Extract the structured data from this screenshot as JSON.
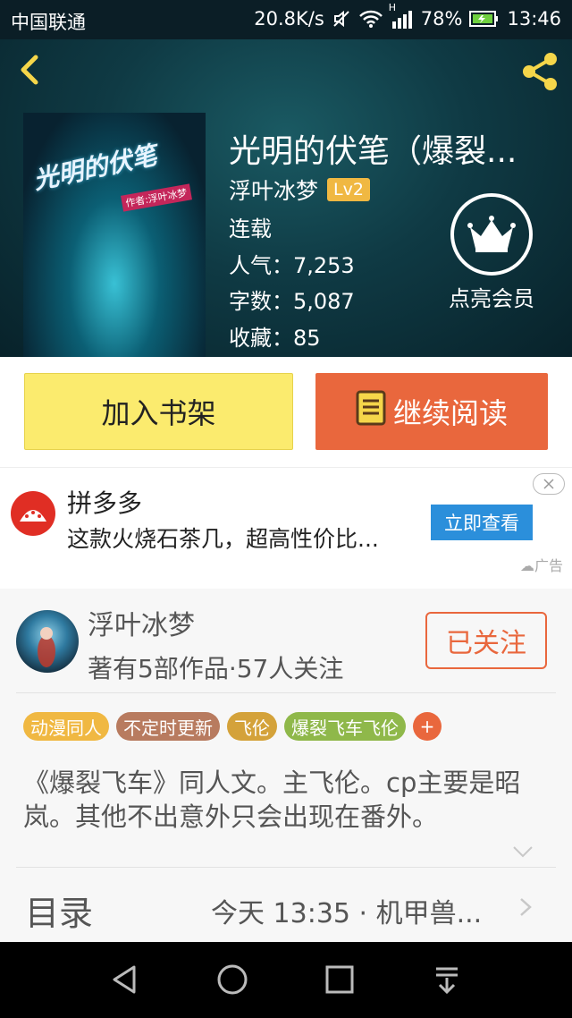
{
  "status_bar": {
    "carrier": "中国联通",
    "net_speed": "20.8K/s",
    "signal_label": "H",
    "battery": "78%",
    "time": "13:46"
  },
  "header": {
    "back_icon": "chevron-left-icon",
    "share_icon": "share-icon"
  },
  "book": {
    "cover_title": "光明的伏笔",
    "cover_subtitle": "作者:浮叶冰梦",
    "title": "光明的伏笔（爆裂...",
    "author": "浮叶冰梦",
    "level": "Lv2",
    "status": "连载",
    "popularity": "人气：7,253",
    "word_count": "字数：5,087",
    "favorites": "收藏：85"
  },
  "vip": {
    "label": "点亮会员",
    "icon": "crown-icon"
  },
  "actions": {
    "add_shelf": "加入书架",
    "continue_read": "继续阅读"
  },
  "ad": {
    "brand": "拼多多",
    "desc": "这款火烧石茶几，超高性价比...",
    "button": "立即查看",
    "tag": "广告"
  },
  "author_card": {
    "name": "浮叶冰梦",
    "stats": "著有5部作品·57人关注",
    "follow": "已关注"
  },
  "tags": [
    {
      "label": "动漫同人",
      "color": "#f0b842"
    },
    {
      "label": "不定时更新",
      "color": "#b87b5f"
    },
    {
      "label": "飞伦",
      "color": "#d4a23a"
    },
    {
      "label": "爆裂飞车飞伦",
      "color": "#8fb84a"
    },
    {
      "label": "+",
      "color": "#e9673d"
    }
  ],
  "description": "《爆裂飞车》同人文。主飞伦。cp主要是昭岚。其他不出意外只会出现在番外。",
  "toc": {
    "label": "目录",
    "latest": "今天 13:35 · 机甲兽..."
  },
  "colors": {
    "accent_orange": "#e9673d",
    "shelf_yellow": "#fbeb6e",
    "ad_blue": "#2b8fdb",
    "level_gold": "#f0b842"
  }
}
